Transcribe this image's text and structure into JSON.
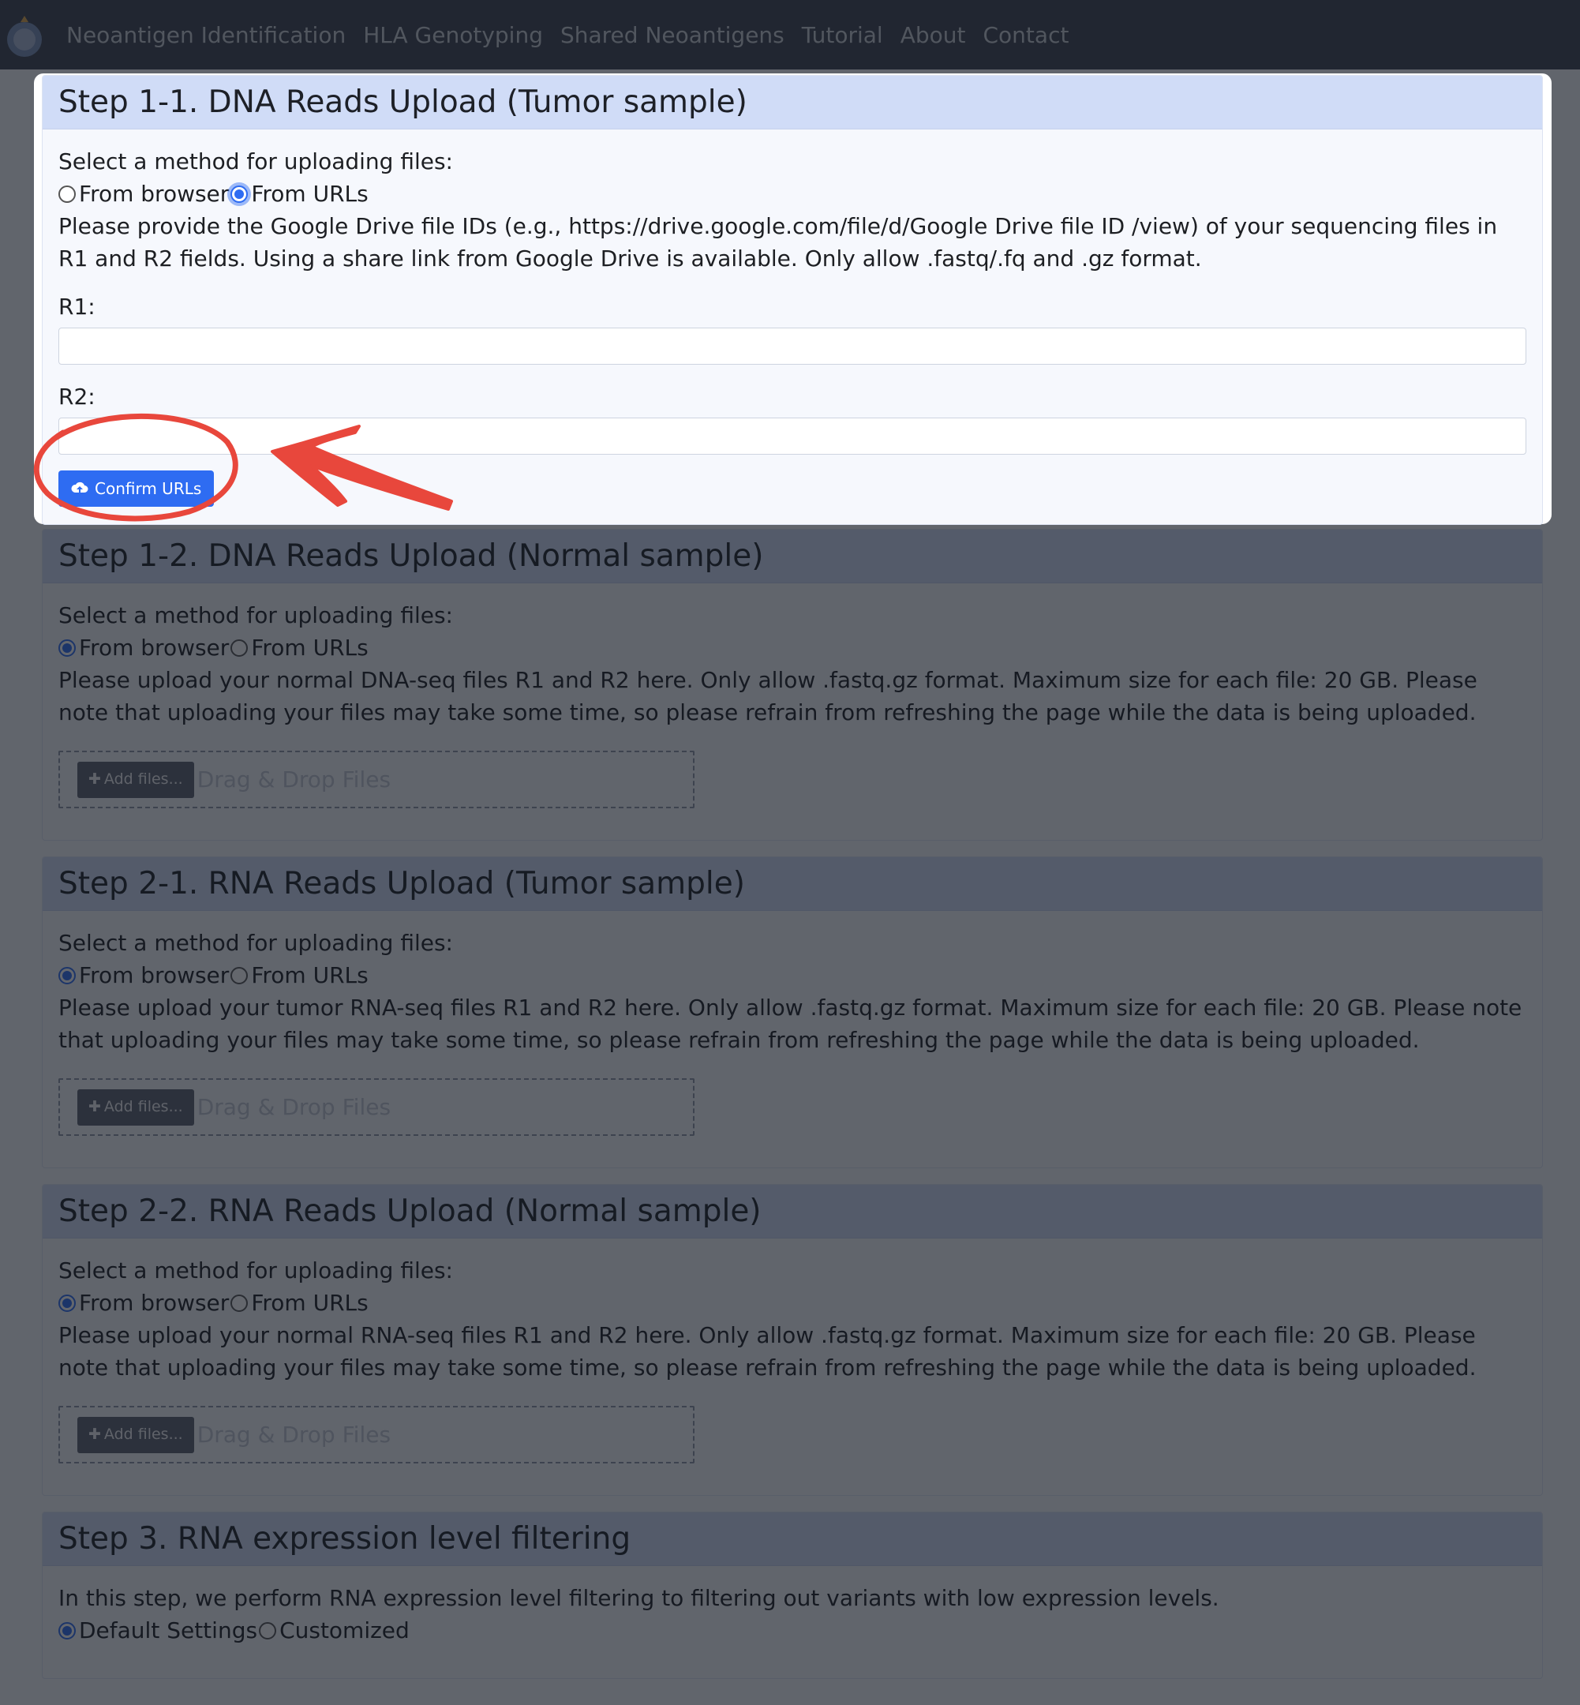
{
  "nav": {
    "items": [
      "Neoantigen Identification",
      "HLA Genotyping",
      "Shared Neoantigens",
      "Tutorial",
      "About",
      "Contact"
    ]
  },
  "step11": {
    "title": "Step 1-1. DNA Reads Upload (Tumor sample)",
    "method_label": "Select a method for uploading files:",
    "option_browser": "From browser",
    "option_urls": "From URLs",
    "instructions": "Please provide the Google Drive file IDs (e.g., https://drive.google.com/file/d/Google Drive file ID /view) of your sequencing files in R1 and R2 fields. Using a share link from Google Drive is available. Only allow .fastq/.fq and .gz format.",
    "r1_label": "R1:",
    "r1_value": "",
    "r2_label": "R2:",
    "r2_value": "",
    "confirm_label": "Confirm URLs"
  },
  "step12": {
    "title": "Step 1-2. DNA Reads Upload (Normal sample)",
    "method_label": "Select a method for uploading files:",
    "option_browser": "From browser",
    "option_urls": "From URLs",
    "instructions": "Please upload your normal DNA-seq files R1 and R2 here. Only allow .fastq.gz format. Maximum size for each file: 20 GB. Please note that uploading your files may take some time, so please refrain from refreshing the page while the data is being uploaded.",
    "add_files": "Add files...",
    "drag_drop": "Drag & Drop Files"
  },
  "step21": {
    "title": "Step 2-1. RNA Reads Upload (Tumor sample)",
    "method_label": "Select a method for uploading files:",
    "option_browser": "From browser",
    "option_urls": "From URLs",
    "instructions": "Please upload your tumor RNA-seq files R1 and R2 here. Only allow .fastq.gz format. Maximum size for each file: 20 GB. Please note that uploading your files may take some time, so please refrain from refreshing the page while the data is being uploaded.",
    "add_files": "Add files...",
    "drag_drop": "Drag & Drop Files"
  },
  "step22": {
    "title": "Step 2-2. RNA Reads Upload (Normal sample)",
    "method_label": "Select a method for uploading files:",
    "option_browser": "From browser",
    "option_urls": "From URLs",
    "instructions": "Please upload your normal RNA-seq files R1 and R2 here. Only allow .fastq.gz format. Maximum size for each file: 20 GB. Please note that uploading your files may take some time, so please refrain from refreshing the page while the data is being uploaded.",
    "add_files": "Add files...",
    "drag_drop": "Drag & Drop Files"
  },
  "step3": {
    "title": "Step 3. RNA expression level filtering",
    "instructions": "In this step, we perform RNA expression level filtering to filtering out variants with low expression levels.",
    "option_default": "Default Settings",
    "option_custom": "Customized"
  },
  "colors": {
    "accent": "#2e6cf2",
    "header": "#d0dcf7",
    "navbar": "#3b4250",
    "annotation": "#e8473c"
  }
}
